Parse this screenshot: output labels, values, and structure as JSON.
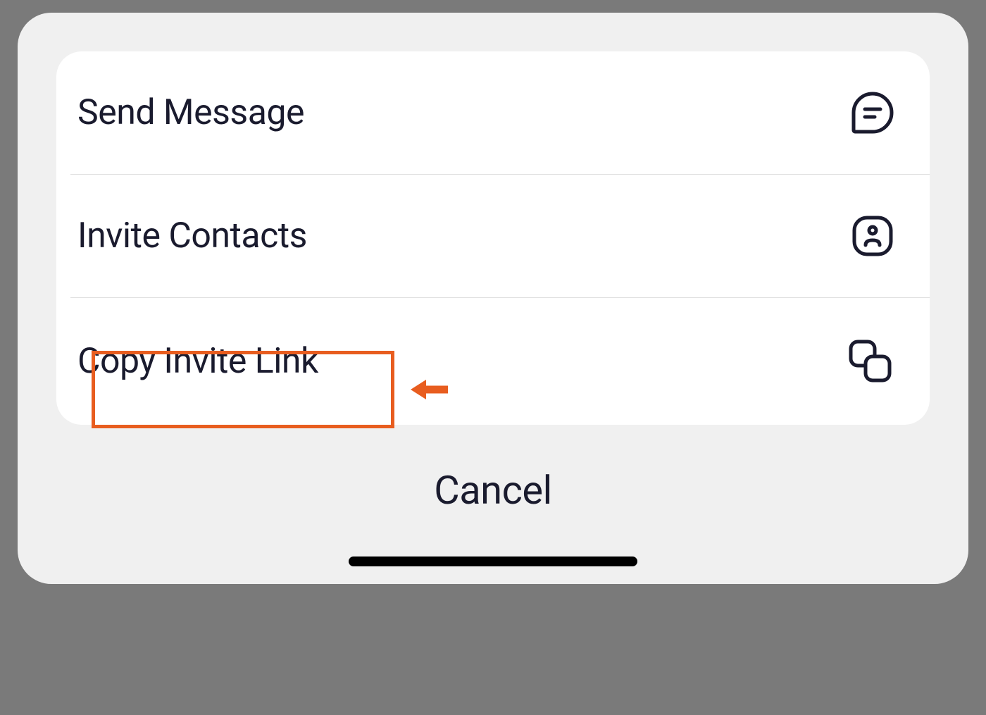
{
  "actions": {
    "sendMessage": {
      "label": "Send Message",
      "icon": "message-icon"
    },
    "inviteContacts": {
      "label": "Invite Contacts",
      "icon": "contact-icon"
    },
    "copyInviteLink": {
      "label": "Copy Invite Link",
      "icon": "copy-icon",
      "highlighted": true
    }
  },
  "cancel": {
    "label": "Cancel"
  },
  "colors": {
    "background": "#7a7a7a",
    "sheet": "#f0f0f0",
    "card": "#ffffff",
    "text": "#1a1b2e",
    "highlight": "#e85d1f",
    "divider": "#e0e0e0"
  }
}
